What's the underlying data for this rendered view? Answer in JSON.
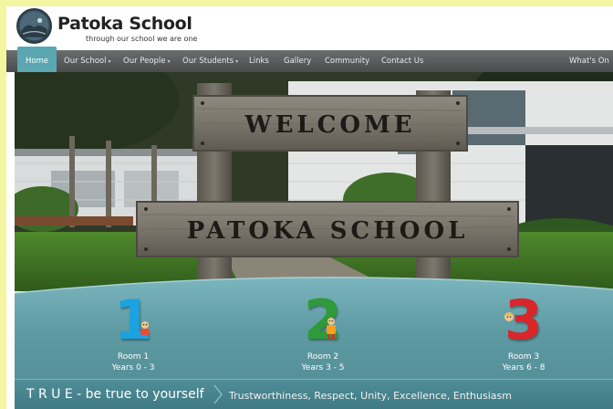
{
  "site": {
    "title": "Patoka School",
    "tagline": "through our school we are one"
  },
  "nav": {
    "items": [
      {
        "label": "Home",
        "active": true
      },
      {
        "label": "Our School",
        "dropdown": true
      },
      {
        "label": "Our People",
        "dropdown": true
      },
      {
        "label": "Our Students",
        "dropdown": true
      },
      {
        "label": "Links"
      },
      {
        "label": "Gallery"
      },
      {
        "label": "Community"
      },
      {
        "label": "Contact Us"
      }
    ],
    "right_item": "What's On"
  },
  "hero": {
    "sign_top": "WELCOME",
    "sign_bottom": "PATOKA SCHOOL"
  },
  "rooms": [
    {
      "number": "1",
      "name": "Room 1",
      "years": "Years 0 - 3",
      "color": "#1aa3e0"
    },
    {
      "number": "2",
      "name": "Room 2",
      "years": "Years 3 - 5",
      "color": "#2e9a3a"
    },
    {
      "number": "3",
      "name": "Room 3",
      "years": "Years 6 - 8",
      "color": "#d9262b"
    }
  ],
  "motto": {
    "main": "T R U E - be true to yourself",
    "values": "Trustworthiness, Respect, Unity, Excellence, Enthusiasm"
  },
  "colors": {
    "page_background": "#f3f5a0",
    "nav_background": "#5a5c5d",
    "nav_active": "#5aa7b1",
    "teal_band": "#5f9ba3",
    "motto_bar": "#4a8792"
  }
}
